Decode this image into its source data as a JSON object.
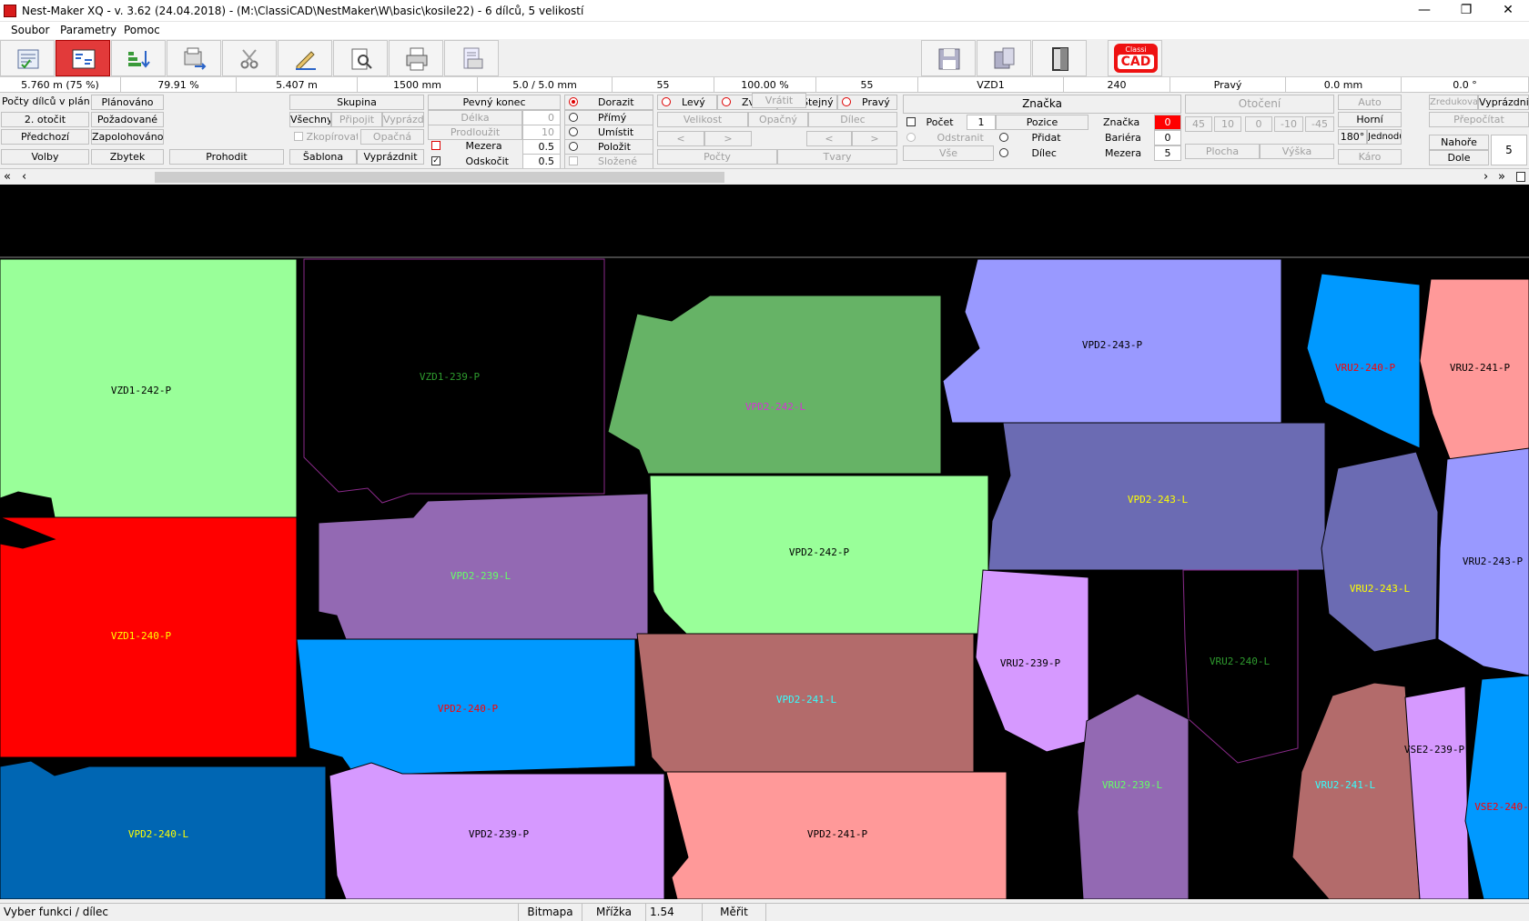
{
  "window": {
    "title": "Nest-Maker XQ - v. 3.62 (24.04.2018) - (M:\\ClassiCAD\\NestMaker\\W\\basic\\kosile22) - 6 dílců, 5 velikostí",
    "minimize": "—",
    "maximize": "❐",
    "close": "✕"
  },
  "menu": [
    "Soubor",
    "Parametry",
    "Pomoc"
  ],
  "toolbar": {
    "icons": [
      "report-icon",
      "layout-icon",
      "sort-down-icon",
      "export-icon",
      "scissors-icon",
      "edit-icon",
      "preview-icon",
      "print-icon",
      "print-setup-icon",
      "save-icon",
      "save-as-icon",
      "exit-icon"
    ],
    "logo_top": "Classi",
    "logo_main": "CAD"
  },
  "status_fields": [
    "5.760 m (75 %)",
    "79.91 %",
    "5.407 m",
    "1500 mm",
    "5.0 / 5.0 mm",
    "55",
    "100.00 %",
    "55",
    "VZD1",
    "240",
    "Pravý",
    "0.0 mm",
    "0.0 °"
  ],
  "panel": {
    "col1": [
      "Počty dílců v plánech",
      "2. otočit",
      "Předchozí",
      "Volby"
    ],
    "col2": [
      "Plánováno",
      "Požadované",
      "Zapolohováno",
      "Zbytek"
    ],
    "prohodit": "Prohodit",
    "skupina": "Skupina",
    "skupina_row": [
      "Všechny",
      "Připojit",
      "Vyprázdnit"
    ],
    "zkopirovat": "Zkopírovat",
    "opacna": "Opačná",
    "sablona": "Šablona",
    "vyprazdnit": "Vyprázdnit",
    "pevny_konec": "Pevný konec",
    "delka_label": "Délka",
    "delka_value": "0",
    "prodlouzit_label": "Prodloužit",
    "prodlouzit_value": "10",
    "mezera_label": "Mezera",
    "mezera_value": "0.5",
    "odskocit_label": "Odskočit",
    "odskocit_value": "0.5",
    "placement": [
      "Dorazit",
      "Přímý",
      "Umístit",
      "Položit",
      "Složené"
    ],
    "side_options": [
      "Levý",
      "Zvolit",
      "Stejný",
      "Pravý"
    ],
    "size_row": [
      "Velikost",
      "Opačný",
      "Dílec"
    ],
    "arrows": [
      "<",
      ">",
      "Vrátit",
      "<",
      ">"
    ],
    "pocty": "Počty",
    "tvary": "Tvary",
    "znacka_header": "Značka",
    "pocet_label": "Počet",
    "pocet_value": "1",
    "pozice": "Pozice",
    "znacka_label": "Značka",
    "znacka_value": "0",
    "odstranit": "Odstranit",
    "pridat": "Přidat",
    "bariera_label": "Bariéra",
    "bariera_value": "0",
    "vse": "Vše",
    "dilec": "Dílec",
    "mezera2_label": "Mezera",
    "mezera2_value": "5",
    "otoceni": "Otočení",
    "angles": [
      "45",
      "10",
      "0",
      "-10",
      "-45"
    ],
    "plocha": "Plocha",
    "vyska": "Výška",
    "auto": "Auto",
    "horni": "Horní",
    "deg180": "180°",
    "jednoduchy": "Jednoduchý",
    "karo": "Káro",
    "zredukovat": "Zredukovat",
    "vyprazdnit2": "Vyprázdnit",
    "prepocitat": "Přepočítat",
    "nahore": "Nahoře",
    "dole": "Dole",
    "count": "5"
  },
  "scroll": {
    "left": "«",
    "prev": "‹",
    "next": "›",
    "right": "»"
  },
  "pieces": [
    {
      "label": "VZD1-242-P",
      "fill": "#99ff99",
      "text": "#000000"
    },
    {
      "label": "VZD1-239-P",
      "fill": "#000000",
      "text": "#2e9a2e"
    },
    {
      "label": "VZD1-240-P",
      "fill": "#ff0000",
      "text": "#ffff00"
    },
    {
      "label": "VPD2-240-L",
      "fill": "#0066b3",
      "text": "#ffff00"
    },
    {
      "label": "VPD2-239-L",
      "fill": "#9369b3",
      "text": "#66ff66"
    },
    {
      "label": "VPD2-240-P",
      "fill": "#0099ff",
      "text": "#ff0000"
    },
    {
      "label": "VPD2-239-P",
      "fill": "#d699ff",
      "text": "#000000"
    },
    {
      "label": "VPD2-242-L",
      "fill": "#66b366",
      "text": "#d633d6"
    },
    {
      "label": "VPD2-242-P",
      "fill": "#99ff99",
      "text": "#000000"
    },
    {
      "label": "VPD2-241-L",
      "fill": "#b36b6b",
      "text": "#33ffff"
    },
    {
      "label": "VPD2-241-P",
      "fill": "#ff9999",
      "text": "#000000"
    },
    {
      "label": "VPD2-243-P",
      "fill": "#9999ff",
      "text": "#000000"
    },
    {
      "label": "VPD2-243-L",
      "fill": "#6b6bb3",
      "text": "#ffff00"
    },
    {
      "label": "VRU2-239-P",
      "fill": "#d699ff",
      "text": "#000000"
    },
    {
      "label": "VRU2-240-L",
      "fill": "#000000",
      "text": "#2e9a2e"
    },
    {
      "label": "VRU2-239-L",
      "fill": "#9369b3",
      "text": "#66ff66"
    },
    {
      "label": "VRU2-240-P",
      "fill": "#0099ff",
      "text": "#ff0000"
    },
    {
      "label": "VRU2-241-P",
      "fill": "#ff9999",
      "text": "#000000"
    },
    {
      "label": "VRU2-243-L",
      "fill": "#6b6bb3",
      "text": "#ffff00"
    },
    {
      "label": "VRU2-243-P",
      "fill": "#9999ff",
      "text": "#000000"
    },
    {
      "label": "VRU2-241-L",
      "fill": "#b36b6b",
      "text": "#33ffff"
    },
    {
      "label": "VSE2-239-P",
      "fill": "#d699ff",
      "text": "#000000"
    },
    {
      "label": "VSE2-240-",
      "fill": "#0099ff",
      "text": "#ff0000"
    }
  ],
  "statusbar": {
    "hint": "Vyber funkci / dílec",
    "bitmapa": "Bitmapa",
    "mrizka": "Mřížka",
    "value": "1.54",
    "merit": "Měřit"
  }
}
